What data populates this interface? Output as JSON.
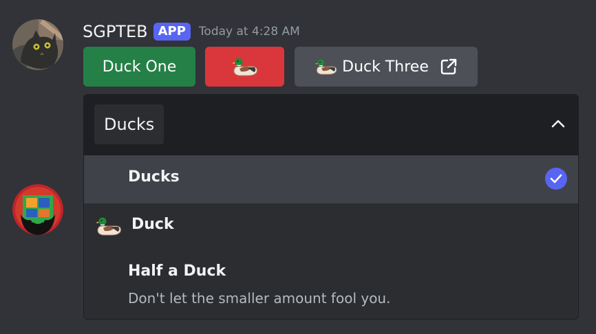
{
  "message": {
    "author": "SGPTEB",
    "app_tag": "APP",
    "timestamp": "Today at 4:28 AM"
  },
  "buttons": {
    "duck_one_label": "Duck One",
    "duck_three_label": "Duck Three"
  },
  "select_menu": {
    "selected_value": "Ducks",
    "options": [
      {
        "label": "Ducks",
        "selected": true
      },
      {
        "label": "Duck",
        "icon": "duck-emoji-icon"
      },
      {
        "label": "Half a Duck",
        "description": "Don't let the smaller amount fool you."
      }
    ]
  },
  "colors": {
    "background": "#313338",
    "success_button": "#248046",
    "danger_button": "#da373c",
    "secondary_button": "#4e5058",
    "brand_blurple": "#5865f2"
  },
  "icons": {
    "author_avatar": "cat-photo-avatar",
    "second_avatar": "bearded-avatar",
    "duck": "duck-emoji-icon",
    "external_link": "external-link-icon",
    "caret": "chevron-up-icon",
    "check": "check-circle-icon"
  }
}
